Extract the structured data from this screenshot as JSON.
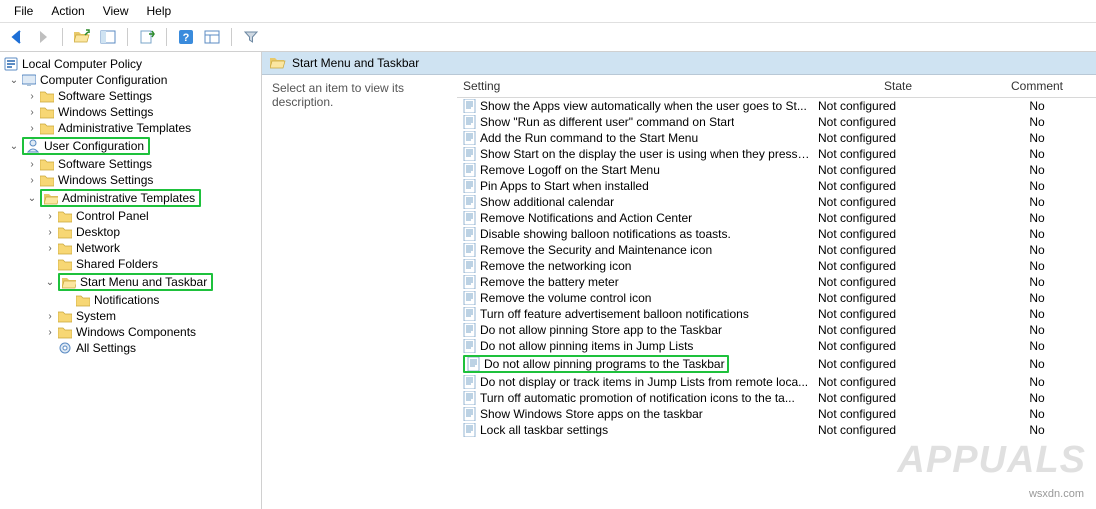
{
  "menubar": [
    "File",
    "Action",
    "View",
    "Help"
  ],
  "tree": {
    "root": "Local Computer Policy",
    "compConfig": "Computer Configuration",
    "compChildren": [
      "Software Settings",
      "Windows Settings",
      "Administrative Templates"
    ],
    "userConfig": "User Configuration",
    "userChildren": [
      "Software Settings",
      "Windows Settings"
    ],
    "adminTemplates": "Administrative Templates",
    "adminChildren": [
      "Control Panel",
      "Desktop",
      "Network",
      "Shared Folders"
    ],
    "startMenu": "Start Menu and Taskbar",
    "notifications": "Notifications",
    "adminTail": [
      "System",
      "Windows Components"
    ],
    "allSettings": "All Settings"
  },
  "rightHeader": "Start Menu and Taskbar",
  "descText": "Select an item to view its description.",
  "columns": {
    "setting": "Setting",
    "state": "State",
    "comment": "Comment"
  },
  "settings": [
    {
      "name": "Show the Apps view automatically when the user goes to St...",
      "state": "Not configured",
      "comment": "No"
    },
    {
      "name": "Show \"Run as different user\" command on Start",
      "state": "Not configured",
      "comment": "No"
    },
    {
      "name": "Add the Run command to the Start Menu",
      "state": "Not configured",
      "comment": "No"
    },
    {
      "name": "Show Start on the display the user is using when they press t...",
      "state": "Not configured",
      "comment": "No"
    },
    {
      "name": "Remove Logoff on the Start Menu",
      "state": "Not configured",
      "comment": "No"
    },
    {
      "name": "Pin Apps to Start when installed",
      "state": "Not configured",
      "comment": "No"
    },
    {
      "name": "Show additional calendar",
      "state": "Not configured",
      "comment": "No"
    },
    {
      "name": "Remove Notifications and Action Center",
      "state": "Not configured",
      "comment": "No"
    },
    {
      "name": "Disable showing balloon notifications as toasts.",
      "state": "Not configured",
      "comment": "No"
    },
    {
      "name": "Remove the Security and Maintenance icon",
      "state": "Not configured",
      "comment": "No"
    },
    {
      "name": "Remove the networking icon",
      "state": "Not configured",
      "comment": "No"
    },
    {
      "name": "Remove the battery meter",
      "state": "Not configured",
      "comment": "No"
    },
    {
      "name": "Remove the volume control icon",
      "state": "Not configured",
      "comment": "No"
    },
    {
      "name": "Turn off feature advertisement balloon notifications",
      "state": "Not configured",
      "comment": "No"
    },
    {
      "name": "Do not allow pinning Store app to the Taskbar",
      "state": "Not configured",
      "comment": "No"
    },
    {
      "name": "Do not allow pinning items in Jump Lists",
      "state": "Not configured",
      "comment": "No"
    },
    {
      "name": "Do not allow pinning programs to the Taskbar",
      "state": "Not configured",
      "comment": "No",
      "highlight": true
    },
    {
      "name": "Do not display or track items in Jump Lists from remote loca...",
      "state": "Not configured",
      "comment": "No"
    },
    {
      "name": "Turn off automatic promotion of notification icons to the ta...",
      "state": "Not configured",
      "comment": "No"
    },
    {
      "name": "Show Windows Store apps on the taskbar",
      "state": "Not configured",
      "comment": "No"
    },
    {
      "name": "Lock all taskbar settings",
      "state": "Not configured",
      "comment": "No"
    }
  ],
  "watermark_small": "wsxdn.com",
  "watermark_big": "APPUALS"
}
